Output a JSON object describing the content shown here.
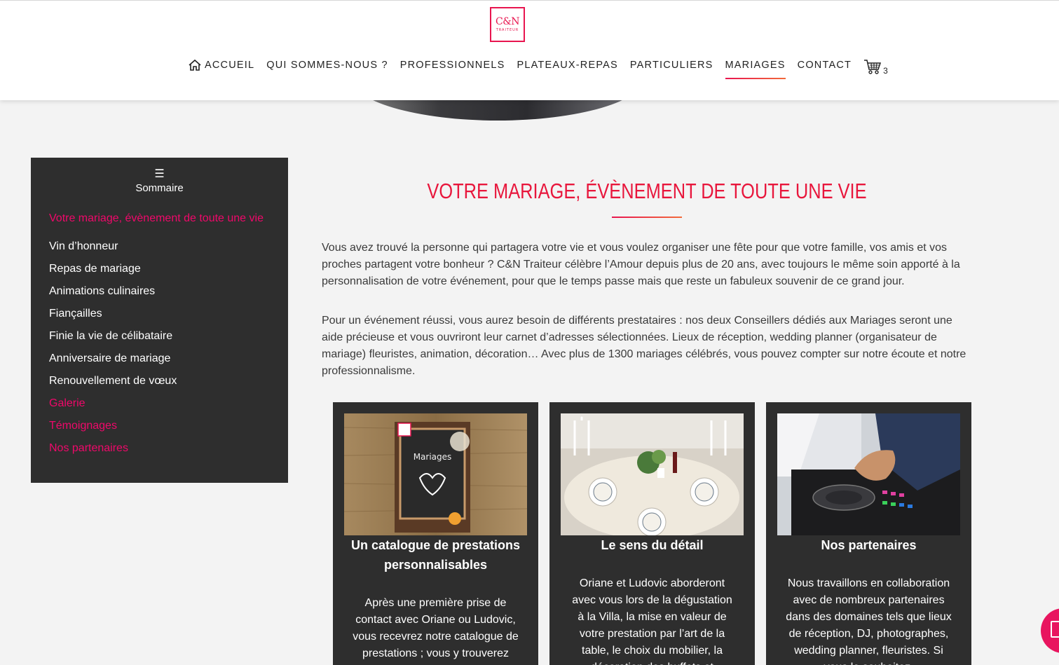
{
  "header": {
    "logo_text": "C&N",
    "logo_sub": "TRAITEUR",
    "nav": [
      {
        "label": "ACCUEIL",
        "icon": "home-icon"
      },
      {
        "label": "QUI SOMMES-NOUS ?"
      },
      {
        "label": "PROFESSIONNELS"
      },
      {
        "label": "PLATEAUX-REPAS"
      },
      {
        "label": "PARTICULIERS"
      },
      {
        "label": "MARIAGES",
        "active": true
      },
      {
        "label": "CONTACT"
      }
    ],
    "cart_count": "3",
    "accent_color": "#e8154f"
  },
  "sidebar": {
    "icon": "menu-icon",
    "title": "Sommaire",
    "items": [
      {
        "label": "Votre mariage, évènement de toute une vie",
        "color": "#f0086a"
      },
      {
        "label": "Vin d’honneur"
      },
      {
        "label": "Repas de mariage"
      },
      {
        "label": "Animations culinaires"
      },
      {
        "label": "Fiançailles"
      },
      {
        "label": "Finie la vie de célibataire"
      },
      {
        "label": "Anniversaire de mariage"
      },
      {
        "label": "Renouvellement de vœux"
      },
      {
        "label": "Galerie",
        "color": "#f0086a"
      },
      {
        "label": "Témoignages",
        "color": "#f0086a"
      },
      {
        "label": "Nos partenaires",
        "color": "#f0086a"
      }
    ]
  },
  "main": {
    "title": "VOTRE MARIAGE, ÉVÈNEMENT DE TOUTE UNE VIE",
    "paragraph1": "Vous avez trouvé la personne qui partagera votre vie et vous voulez organiser une fête pour que votre famille, vos amis et vos proches partagent votre bonheur ? C&N Traiteur célèbre l’Amour depuis plus de 20 ans, avec toujours le même soin apporté à la personnalisation de votre événement, pour que le temps passe mais que reste un fabuleux souvenir de ce grand jour.",
    "paragraph2": "Pour un événement réussi, vous aurez besoin de différents prestataires : nos deux Conseillers dédiés aux Mariages seront une aide précieuse et vous ouvriront leur carnet d’adresses sélectionnées. Lieux de réception, wedding planner (organisateur de mariage) fleuristes, animation, décoration… Avec plus de 1300 mariages célébrés, vous pouvez compter sur notre écoute et notre professionnalisme.",
    "cards": [
      {
        "title": "Un catalogue de prestations personnalisables",
        "image_text": "Mariages",
        "text": "Après une première prise de contact avec Oriane ou Ludovic, vous recevrez notre catalogue de prestations ; vous y trouverez"
      },
      {
        "title": "Le sens du détail",
        "text": "Oriane et Ludovic aborderont avec vous lors de la dégustation à la Villa, la mise en valeur de votre prestation par l’art de la table, le choix du mobilier, la décoration des buffets et"
      },
      {
        "title": "Nos partenaires",
        "text": "Nous travaillons en collaboration avec de nombreux partenaires dans des domaines tels que lieux de réception, DJ, photographes, wedding planner, fleuristes. Si vous le souhaitez,"
      }
    ]
  }
}
